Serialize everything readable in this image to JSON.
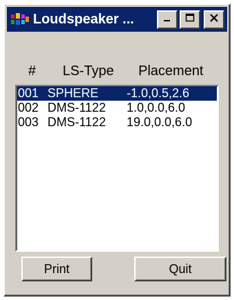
{
  "window": {
    "title": "Loudspeaker ...",
    "controls": {
      "minimize_icon": "minimize-icon",
      "maximize_icon": "maximize-icon",
      "close_icon": "close-icon"
    }
  },
  "table": {
    "columns": [
      "#",
      "LS-Type",
      "Placement"
    ],
    "rows": [
      {
        "num": "001",
        "type": "SPHERE",
        "placement": "-1.0,0.5,2.6",
        "selected": true
      },
      {
        "num": "002",
        "type": "DMS-1122",
        "placement": "1.0,0.0,6.0",
        "selected": false
      },
      {
        "num": "003",
        "type": "DMS-1122",
        "placement": "19.0,0.0,6.0",
        "selected": false
      }
    ]
  },
  "buttons": {
    "print_label": "Print",
    "quit_label": "Quit"
  },
  "colors": {
    "title_bar": "#0a246a",
    "selection": "#0a246a",
    "face": "#d4d0c8"
  }
}
